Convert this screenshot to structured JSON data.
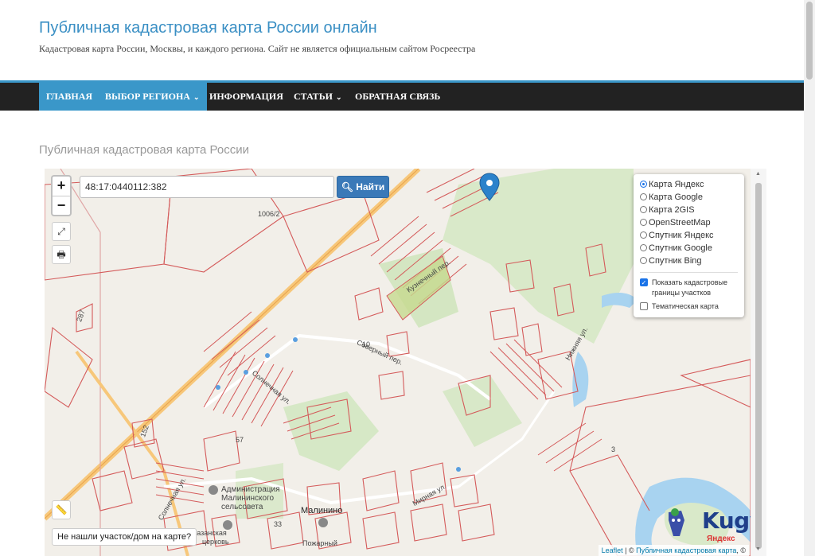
{
  "site": {
    "title": "Публичная кадастровая карта России онлайн",
    "subtitle": "Кадастровая карта России, Москвы, и каждого региона. Сайт не является официальным сайтом Росреестра"
  },
  "nav": {
    "items": [
      {
        "label": "ГЛАВНАЯ",
        "active": true
      },
      {
        "label": "ВЫБОР РЕГИОНА",
        "caret": true
      },
      {
        "label": "ИНФОРМАЦИЯ"
      },
      {
        "label": "СТАТЬИ",
        "caret": true
      },
      {
        "label": "ОБРАТНАЯ СВЯЗЬ"
      }
    ]
  },
  "page": {
    "heading": "Публичная кадастровая карта России"
  },
  "map": {
    "search_value": "48:17:0440112:382",
    "search_button": "Найти",
    "zoom_in": "+",
    "zoom_out": "−",
    "layers": [
      {
        "label": "Карта Яндекс",
        "selected": true
      },
      {
        "label": "Карта Google"
      },
      {
        "label": "Карта 2GIS"
      },
      {
        "label": "OpenStreetMap"
      },
      {
        "label": "Спутник Яндекс"
      },
      {
        "label": "Спутник Google"
      },
      {
        "label": "Спутник Bing"
      }
    ],
    "overlays": [
      {
        "label": "Показать кадастровые границы участков",
        "checked": true
      },
      {
        "label": "Тематическая карта",
        "checked": false
      }
    ],
    "not_found_button": "Не нашли участок/дом на карте?",
    "attribution_leaflet": "Leaflet",
    "attribution_sep": " | © ",
    "attribution_site": "Публичная кадастровая карта",
    "attribution_tail": ", ©",
    "labels": {
      "parcel_1006": "1006/2",
      "parcel_287": "287",
      "parcel_152": "152",
      "parcel_3": "3",
      "parcel_10": "10",
      "parcel_57": "57",
      "parcel_33": "33",
      "street_severny": "Северный пер.",
      "street_solnechnaya": "Солнечная ул.",
      "street_solnechnaya2": "Солнечная ул.",
      "street_mirnaya": "Мирная ул.",
      "street_nizhnyaya": "Нижняя ул.",
      "street_kuznechny": "Кузнечный пер.",
      "admin": "Администрация",
      "admin2": "Малининского",
      "admin3": "сельсовета",
      "village": "Малинино",
      "pozharny": "Пожарный",
      "church": "Казанская",
      "church2": "церковь"
    },
    "watermark_text": "Kugy.ru",
    "yandex": "Яндекс"
  }
}
